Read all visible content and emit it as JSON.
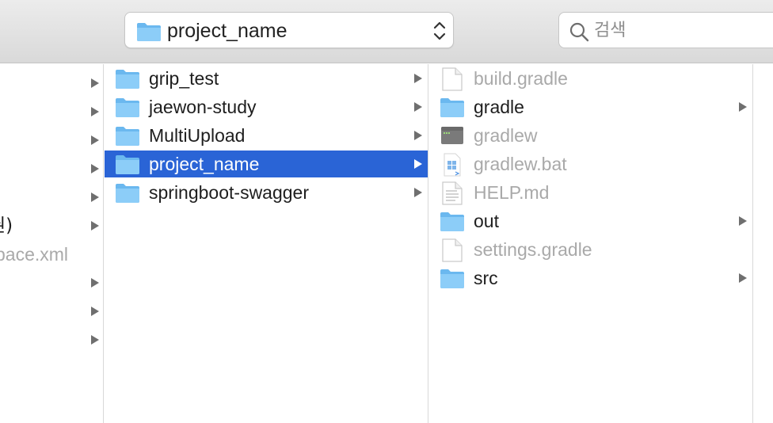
{
  "toolbar": {
    "path_label": "project_name",
    "search_placeholder": "검색"
  },
  "column1": {
    "rows": [
      {
        "fragment": "",
        "has_arrow": true
      },
      {
        "fragment": "",
        "has_arrow": true
      },
      {
        "fragment": "",
        "has_arrow": true
      },
      {
        "fragment": "",
        "has_arrow": true
      },
      {
        "fragment": "",
        "has_arrow": true
      },
      {
        "fragment": "권)",
        "has_arrow": true
      },
      {
        "fragment": "pace.xml",
        "has_arrow": false,
        "dim": true
      },
      {
        "fragment": "",
        "has_arrow": true
      },
      {
        "fragment": "",
        "has_arrow": true
      },
      {
        "fragment": "",
        "has_arrow": true
      }
    ]
  },
  "column2": {
    "items": [
      {
        "label": "grip_test",
        "icon": "folder-icon"
      },
      {
        "label": "jaewon-study",
        "icon": "folder-icon"
      },
      {
        "label": "MultiUpload",
        "icon": "folder-icon"
      },
      {
        "label": "project_name",
        "icon": "folder-icon",
        "selected": true
      },
      {
        "label": "springboot-swagger",
        "icon": "folder-icon"
      }
    ]
  },
  "column3": {
    "items": [
      {
        "label": "build.gradle",
        "icon": "document-icon"
      },
      {
        "label": "gradle",
        "icon": "folder-icon"
      },
      {
        "label": "gradlew",
        "icon": "terminal-executable-icon"
      },
      {
        "label": "gradlew.bat",
        "icon": "windows-batch-file-icon"
      },
      {
        "label": "HELP.md",
        "icon": "text-document-icon"
      },
      {
        "label": "out",
        "icon": "folder-icon"
      },
      {
        "label": "settings.gradle",
        "icon": "document-icon"
      },
      {
        "label": "src",
        "icon": "folder-icon"
      }
    ]
  },
  "colors": {
    "selection": "#2a64d6",
    "folder": "#7cc4f5",
    "dim_text": "#a9a9a9"
  }
}
